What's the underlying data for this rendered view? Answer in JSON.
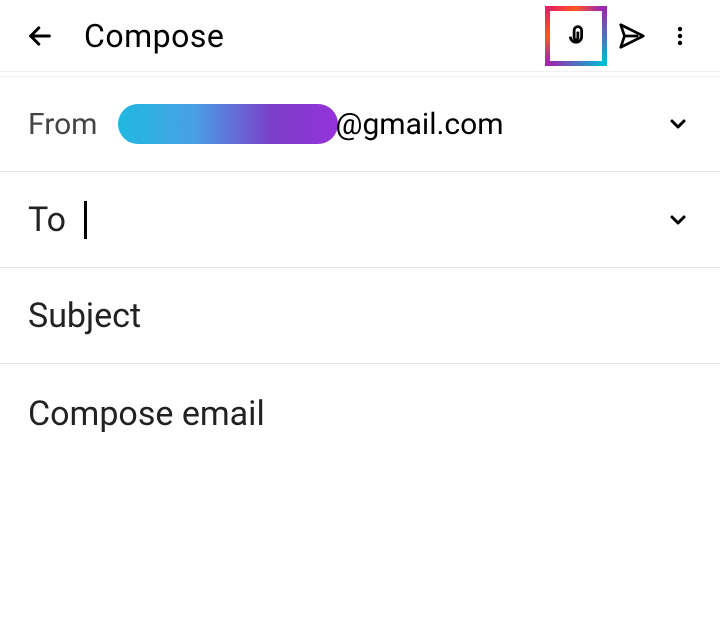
{
  "header": {
    "title": "Compose"
  },
  "fields": {
    "from_label": "From",
    "from_domain": "@gmail.com",
    "to_label": "To",
    "subject_placeholder": "Subject",
    "compose_placeholder": "Compose email"
  }
}
